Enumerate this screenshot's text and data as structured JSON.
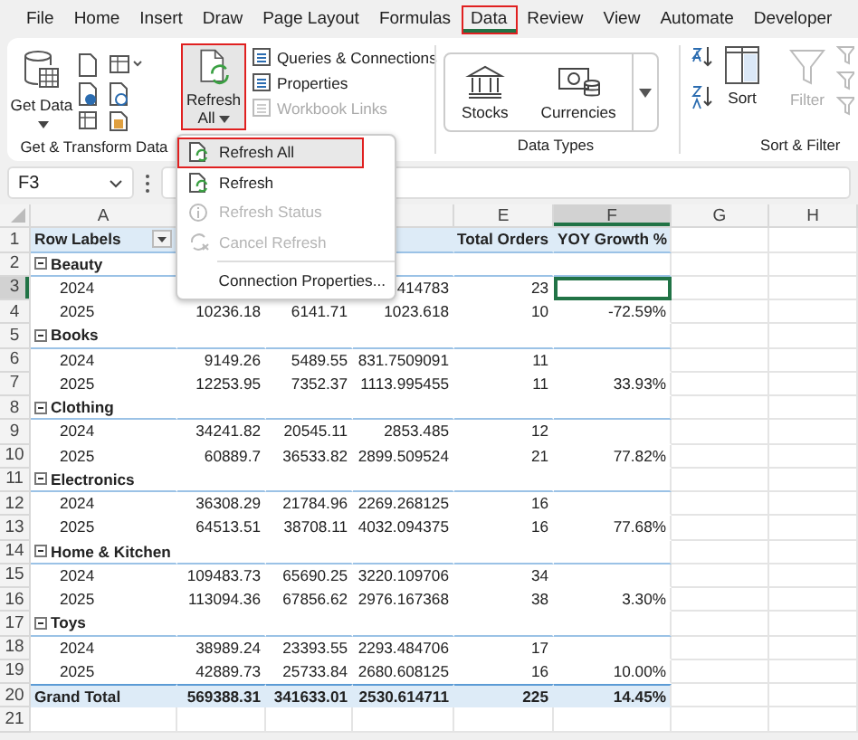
{
  "ribbon_tabs": [
    {
      "label": "File",
      "selected": false,
      "highlighted": false
    },
    {
      "label": "Home",
      "selected": false,
      "highlighted": false
    },
    {
      "label": "Insert",
      "selected": false,
      "highlighted": false
    },
    {
      "label": "Draw",
      "selected": false,
      "highlighted": false
    },
    {
      "label": "Page Layout",
      "selected": false,
      "highlighted": false
    },
    {
      "label": "Formulas",
      "selected": false,
      "highlighted": false
    },
    {
      "label": "Data",
      "selected": true,
      "highlighted": true
    },
    {
      "label": "Review",
      "selected": false,
      "highlighted": false
    },
    {
      "label": "View",
      "selected": false,
      "highlighted": false
    },
    {
      "label": "Automate",
      "selected": false,
      "highlighted": false
    },
    {
      "label": "Developer",
      "selected": false,
      "highlighted": false
    }
  ],
  "get_transform": {
    "get_data": "Get Data",
    "group_label": "Get & Transform Data"
  },
  "refresh_all_button": {
    "label": "Refresh All",
    "pressed": true,
    "highlighted": true
  },
  "connections": [
    {
      "label": "Queries & Connections",
      "disabled": false
    },
    {
      "label": "Properties",
      "disabled": false
    },
    {
      "label": "Workbook Links",
      "disabled": true
    }
  ],
  "data_types": {
    "items": [
      "Stocks",
      "Currencies"
    ],
    "group_label": "Data Types"
  },
  "sort_filter": {
    "sort": "Sort",
    "filter": {
      "label": "Filter",
      "disabled": true
    },
    "group_label": "Sort & Filter"
  },
  "name_box": "F3",
  "refresh_menu": [
    {
      "label": "Refresh All",
      "kind": "refresh-all",
      "disabled": false,
      "selected": true,
      "highlighted": true
    },
    {
      "label": "Refresh",
      "kind": "refresh",
      "disabled": false,
      "selected": false,
      "highlighted": false
    },
    {
      "label": "Refresh Status",
      "kind": "status",
      "disabled": true,
      "selected": false,
      "highlighted": false
    },
    {
      "label": "Cancel Refresh",
      "kind": "cancel",
      "disabled": true,
      "selected": false,
      "highlighted": false
    },
    {
      "label": "Connection Properties...",
      "kind": "properties",
      "disabled": false,
      "selected": false,
      "highlighted": false
    }
  ],
  "grid": {
    "columns": [
      {
        "kind": "shown",
        "label": "A",
        "selected": false
      },
      {
        "kind": "covered"
      },
      {
        "kind": "covered"
      },
      {
        "kind": "partial",
        "selected": false
      },
      {
        "kind": "shown",
        "label": "E",
        "selected": false
      },
      {
        "kind": "shown",
        "label": "F",
        "selected": true
      },
      {
        "kind": "shown",
        "label": "G",
        "selected": false
      },
      {
        "kind": "shown",
        "label": "H",
        "selected": false
      }
    ],
    "rows": [
      {
        "number": "1",
        "kind": "header",
        "selected": false,
        "cells": [
          "Row Labels",
          null,
          null,
          null,
          "Total Orders",
          "YOY Growth %"
        ]
      },
      {
        "number": "2",
        "kind": "group",
        "selected": false,
        "cells": [
          "Beauty"
        ]
      },
      {
        "number": "3",
        "kind": "item",
        "selected": true,
        "cells": [
          "2024",
          null,
          null,
          "414783",
          "23",
          null
        ]
      },
      {
        "number": "4",
        "kind": "item",
        "selected": false,
        "cells": [
          "2025",
          "10236.18",
          "6141.71",
          "1023.618",
          "10",
          "-72.59%"
        ]
      },
      {
        "number": "5",
        "kind": "group",
        "selected": false,
        "cells": [
          "Books"
        ]
      },
      {
        "number": "6",
        "kind": "item",
        "selected": false,
        "cells": [
          "2024",
          "9149.26",
          "5489.55",
          "831.7509091",
          "11",
          null
        ]
      },
      {
        "number": "7",
        "kind": "item",
        "selected": false,
        "cells": [
          "2025",
          "12253.95",
          "7352.37",
          "1113.995455",
          "11",
          "33.93%"
        ]
      },
      {
        "number": "8",
        "kind": "group",
        "selected": false,
        "cells": [
          "Clothing"
        ]
      },
      {
        "number": "9",
        "kind": "item",
        "selected": false,
        "cells": [
          "2024",
          "34241.82",
          "20545.11",
          "2853.485",
          "12",
          null
        ]
      },
      {
        "number": "10",
        "kind": "item",
        "selected": false,
        "cells": [
          "2025",
          "60889.7",
          "36533.82",
          "2899.509524",
          "21",
          "77.82%"
        ]
      },
      {
        "number": "11",
        "kind": "group",
        "selected": false,
        "cells": [
          "Electronics"
        ]
      },
      {
        "number": "12",
        "kind": "item",
        "selected": false,
        "cells": [
          "2024",
          "36308.29",
          "21784.96",
          "2269.268125",
          "16",
          null
        ]
      },
      {
        "number": "13",
        "kind": "item",
        "selected": false,
        "cells": [
          "2025",
          "64513.51",
          "38708.11",
          "4032.094375",
          "16",
          "77.68%"
        ]
      },
      {
        "number": "14",
        "kind": "group",
        "selected": false,
        "cells": [
          "Home & Kitchen"
        ]
      },
      {
        "number": "15",
        "kind": "item",
        "selected": false,
        "cells": [
          "2024",
          "109483.73",
          "65690.25",
          "3220.109706",
          "34",
          null
        ]
      },
      {
        "number": "16",
        "kind": "item",
        "selected": false,
        "cells": [
          "2025",
          "113094.36",
          "67856.62",
          "2976.167368",
          "38",
          "3.30%"
        ]
      },
      {
        "number": "17",
        "kind": "group",
        "selected": false,
        "cells": [
          "Toys"
        ]
      },
      {
        "number": "18",
        "kind": "item",
        "selected": false,
        "cells": [
          "2024",
          "38989.24",
          "23393.55",
          "2293.484706",
          "17",
          null
        ]
      },
      {
        "number": "19",
        "kind": "item",
        "selected": false,
        "cells": [
          "2025",
          "42889.73",
          "25733.84",
          "2680.608125",
          "16",
          "10.00%"
        ]
      },
      {
        "number": "20",
        "kind": "total",
        "selected": false,
        "cells": [
          "Grand Total",
          "569388.31",
          "341633.01",
          "2530.614711",
          "225",
          "14.45%"
        ]
      },
      {
        "number": "21",
        "kind": "empty",
        "selected": false,
        "cells": []
      }
    ]
  }
}
